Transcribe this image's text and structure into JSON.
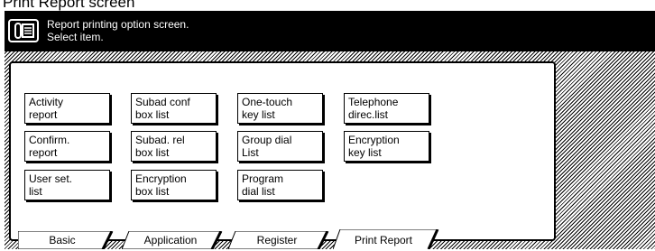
{
  "page": {
    "title": "Print Report screen"
  },
  "header": {
    "line1": "Report printing option screen.",
    "line2": "Select item.",
    "icon": "fax-machine-icon"
  },
  "options": {
    "activity_report": {
      "line1": "Activity",
      "line2": "report"
    },
    "subad_conf_box_list": {
      "line1": "Subad conf",
      "line2": "box list"
    },
    "one_touch_key_list": {
      "line1": "One-touch",
      "line2": "key list"
    },
    "telephone_direc_list": {
      "line1": "Telephone",
      "line2": "direc.list"
    },
    "confirm_report": {
      "line1": "Confirm.",
      "line2": "report"
    },
    "subad_rel_box_list": {
      "line1": "Subad. rel",
      "line2": "box list"
    },
    "group_dial_list": {
      "line1": "Group dial",
      "line2": "List"
    },
    "encryption_key_list": {
      "line1": "Encryption",
      "line2": "key list"
    },
    "user_set_list": {
      "line1": "User set.",
      "line2": "list"
    },
    "encryption_box_list": {
      "line1": "Encryption",
      "line2": "box list"
    },
    "program_dial_list": {
      "line1": "Program",
      "line2": "dial list"
    }
  },
  "tabs": {
    "basic": "Basic",
    "application": "Application",
    "register": "Register",
    "print_report": "Print Report",
    "active": "Print Report"
  }
}
